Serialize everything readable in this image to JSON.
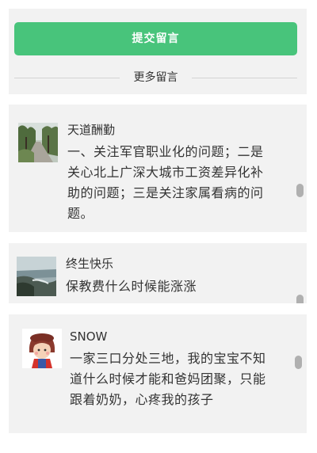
{
  "top": {
    "submit_label": "提交留言",
    "more_label": "更多留言"
  },
  "colors": {
    "accent_green": "#48c47b",
    "panel_bg": "#f2f2f2",
    "text": "#333333"
  },
  "comments": [
    {
      "avatar_icon": "tree-lined-road-photo",
      "name": "天道酬勤",
      "text": "一、关注军官职业化的问题；二是关心北上广深大城市工资差异化补助的问题；三是关注家属看病的问题。"
    },
    {
      "avatar_icon": "seashore-photo",
      "name": "终生快乐",
      "text": "保教费什么时候能涨涨"
    },
    {
      "avatar_icon": "cartoon-girl-avatar",
      "name": "SNOW",
      "text": "一家三口分处三地，我的宝宝不知道什么时候才能和爸妈团聚，只能跟着奶奶，心疼我的孩子"
    }
  ]
}
